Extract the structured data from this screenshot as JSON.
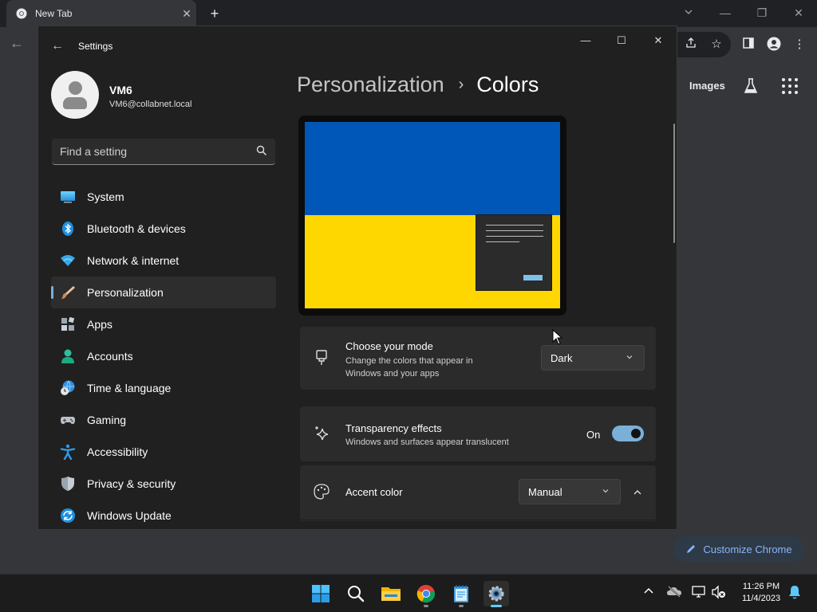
{
  "chrome": {
    "tab_title": "New Tab",
    "tab_close": "✕",
    "new_tab": "+",
    "images_label": "Images",
    "customize_label": "Customize Chrome"
  },
  "settings": {
    "app_name": "Settings",
    "window_controls": {
      "minimize": "—",
      "maximize": "☐",
      "close": "✕"
    },
    "profile": {
      "name": "VM6",
      "email": "VM6@collabnet.local"
    },
    "search": {
      "placeholder": "Find a setting"
    },
    "nav": [
      {
        "label": "System",
        "icon": "system-icon"
      },
      {
        "label": "Bluetooth & devices",
        "icon": "bluetooth-icon"
      },
      {
        "label": "Network & internet",
        "icon": "wifi-icon"
      },
      {
        "label": "Personalization",
        "icon": "brush-icon",
        "active": true
      },
      {
        "label": "Apps",
        "icon": "apps-icon"
      },
      {
        "label": "Accounts",
        "icon": "accounts-icon"
      },
      {
        "label": "Time & language",
        "icon": "globe-clock-icon"
      },
      {
        "label": "Gaming",
        "icon": "gamepad-icon"
      },
      {
        "label": "Accessibility",
        "icon": "accessibility-icon"
      },
      {
        "label": "Privacy & security",
        "icon": "shield-icon"
      },
      {
        "label": "Windows Update",
        "icon": "update-icon"
      }
    ],
    "breadcrumb": {
      "parent": "Personalization",
      "separator": "›",
      "current": "Colors"
    },
    "mode_card": {
      "title": "Choose your mode",
      "desc_line1": "Change the colors that appear in",
      "desc_line2": "Windows and your apps",
      "value": "Dark"
    },
    "transparency_card": {
      "title": "Transparency effects",
      "desc": "Windows and surfaces appear translucent",
      "state_label": "On",
      "enabled": true
    },
    "accent_card": {
      "title": "Accent color",
      "value": "Manual",
      "expanded": true
    }
  },
  "taskbar": {
    "apps": [
      "start-icon",
      "search-icon",
      "file-explorer-icon",
      "chrome-icon",
      "notepad-icon",
      "settings-icon"
    ],
    "clock_time": "11:26 PM",
    "clock_date": "11/4/2023"
  },
  "colors": {
    "accent": "#7ab0d8",
    "flag_blue": "#0057b7",
    "flag_yellow": "#ffd700"
  }
}
